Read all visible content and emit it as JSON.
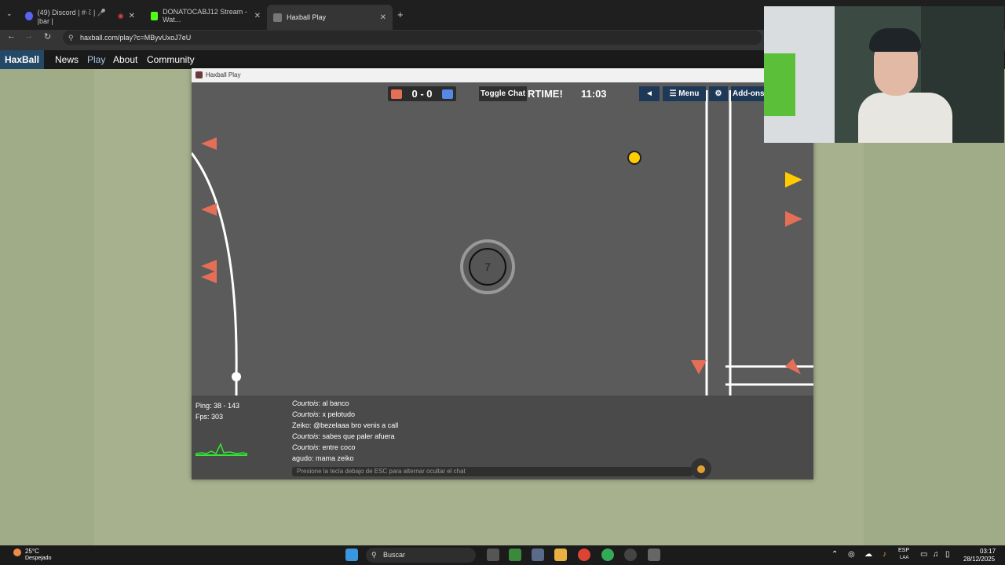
{
  "browser": {
    "tabs": [
      {
        "label": "(49) Discord | #·ﾐ | 🎤 |bar |",
        "icon": "discord-icon",
        "color": "#5865f2"
      },
      {
        "label": "DONATOCABJ12 Stream - Wat...",
        "icon": "kick-icon",
        "color": "#53fc18"
      },
      {
        "label": "Haxball Play",
        "icon": "haxball-icon",
        "color": "#777777"
      }
    ],
    "new_tab": "+",
    "url": "haxball.com/play?c=MByvUxoJ7eU"
  },
  "site_nav": {
    "logo": "HaxBall",
    "links": [
      "News",
      "Play",
      "About",
      "Community"
    ]
  },
  "game_window": {
    "title": "Haxball Play",
    "score": "0 - 0",
    "toggle_chat": "Toggle Chat",
    "overtime": "RTIME!",
    "clock": "11:03",
    "menu_buttons": [
      "◄",
      "☰ Menu",
      "⚙",
      "Add-ons"
    ],
    "player_number": "7",
    "colors": {
      "red": "#e56e56",
      "blue": "#5689e5",
      "ball": "#ffcc00"
    }
  },
  "chat": {
    "stats": {
      "ping": "Ping: 38 - 143",
      "fps": "Fps: 303"
    },
    "messages": [
      {
        "user": "Courtois",
        "text": ": al banco",
        "italic": true
      },
      {
        "user": "Courtois",
        "text": ": x pelotudo",
        "italic": true
      },
      {
        "user": "Zeiko",
        "text": ": @bezelaaa bro venis a call",
        "italic": false
      },
      {
        "user": "Courtois",
        "text": ": sabes que paler afuera",
        "italic": true
      },
      {
        "user": "Courtois",
        "text": ": entre coco",
        "italic": true
      },
      {
        "user": "agudo",
        "text": ": mama zeiko",
        "italic": false
      }
    ],
    "placeholder": "Presione la tecla debajo de ESC para alternar ocultar el chat"
  },
  "taskbar": {
    "weather_temp": "25°C",
    "weather_desc": "Despejado",
    "search": "Buscar",
    "lang": "ESP",
    "lang_sub": "LAA",
    "time": "03:17",
    "date": "28/12/2025"
  }
}
